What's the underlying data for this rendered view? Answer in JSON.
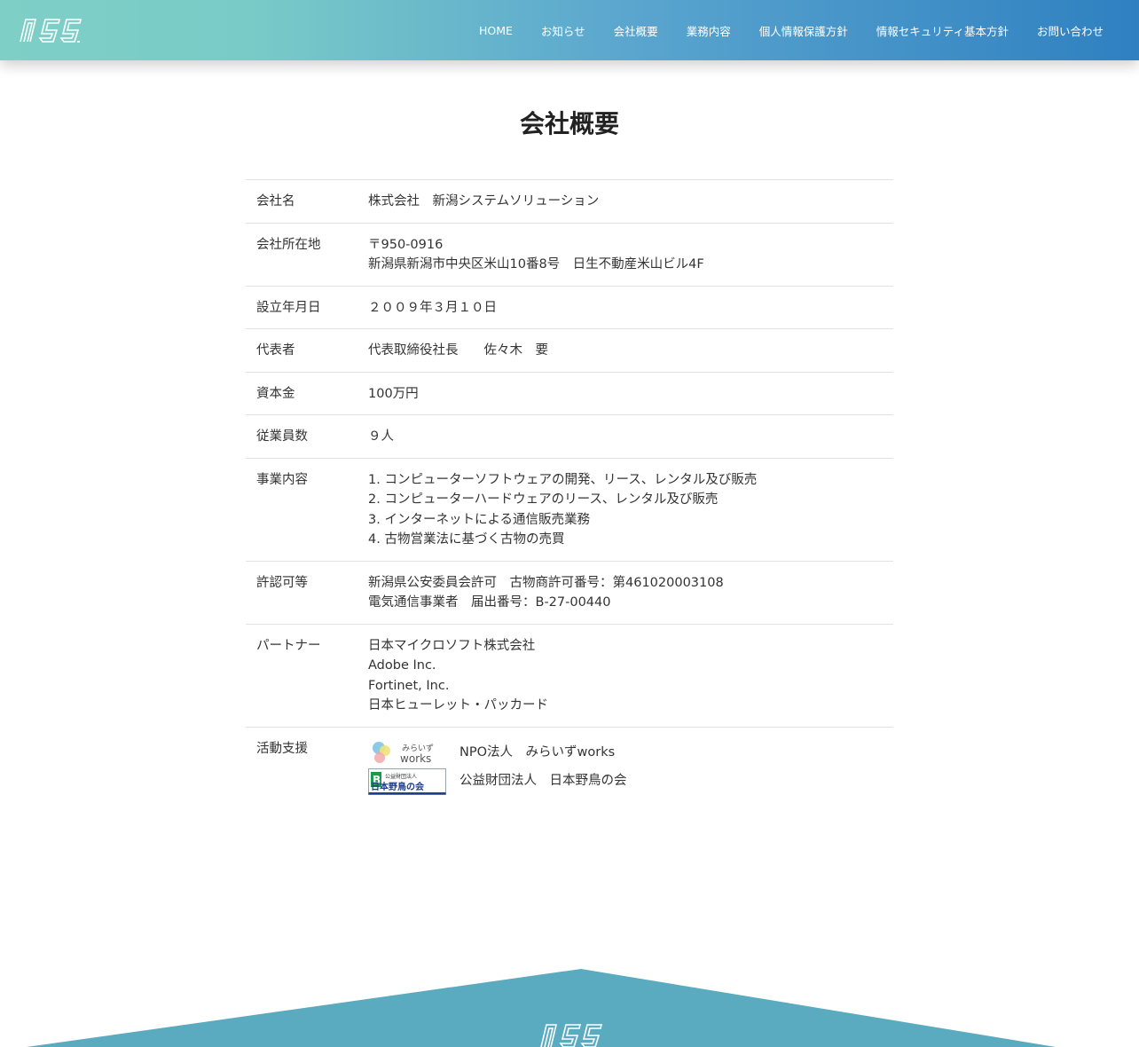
{
  "header": {
    "logo_text": "NSS",
    "nav": [
      "HOME",
      "お知らせ",
      "会社概要",
      "業務内容",
      "個人情報保護方針",
      "情報セキュリティ基本方針",
      "お問い合わせ"
    ]
  },
  "page": {
    "title": "会社概要"
  },
  "company": {
    "rows": [
      {
        "label": "会社名",
        "lines": [
          "株式会社　新潟システムソリューション"
        ]
      },
      {
        "label": "会社所在地",
        "lines": [
          "〒950-0916",
          "新潟県新潟市中央区米山10番8号　日生不動産米山ビル4F"
        ]
      },
      {
        "label": "設立年月日",
        "lines": [
          "２００９年３月１０日"
        ]
      },
      {
        "label": "代表者",
        "lines": [
          "代表取締役社長　　佐々木　要"
        ]
      },
      {
        "label": "資本金",
        "lines": [
          "100万円"
        ]
      },
      {
        "label": "従業員数",
        "lines": [
          "９人"
        ]
      },
      {
        "label": "事業内容",
        "lines": [
          "1. コンピューターソフトウェアの開発、リース、レンタル及び販売",
          "2. コンピューターハードウェアのリース、レンタル及び販売",
          "3. インターネットによる通信販売業務",
          "4. 古物営業法に基づく古物の売買"
        ]
      },
      {
        "label": "許認可等",
        "lines": [
          "新潟県公安委員会許可　古物商許可番号：第461020003108",
          "電気通信事業者　届出番号：B-27-00440"
        ]
      },
      {
        "label": "パートナー",
        "lines": [
          "日本マイクロソフト株式会社",
          "Adobe Inc.",
          "Fortinet, Inc.",
          "日本ヒューレット・パッカード"
        ]
      }
    ],
    "support": {
      "label": "活動支援",
      "items": [
        {
          "logo_text": "みらいず works",
          "text": "NPO法人　みらいずworks"
        },
        {
          "logo_text": "公益財団法人 日本野鳥の会",
          "text": "公益財団法人　日本野鳥の会"
        }
      ]
    }
  },
  "colors": {
    "header_start": "#7ecfc6",
    "header_end": "#2f80c1",
    "footer": "#5aabbf"
  }
}
